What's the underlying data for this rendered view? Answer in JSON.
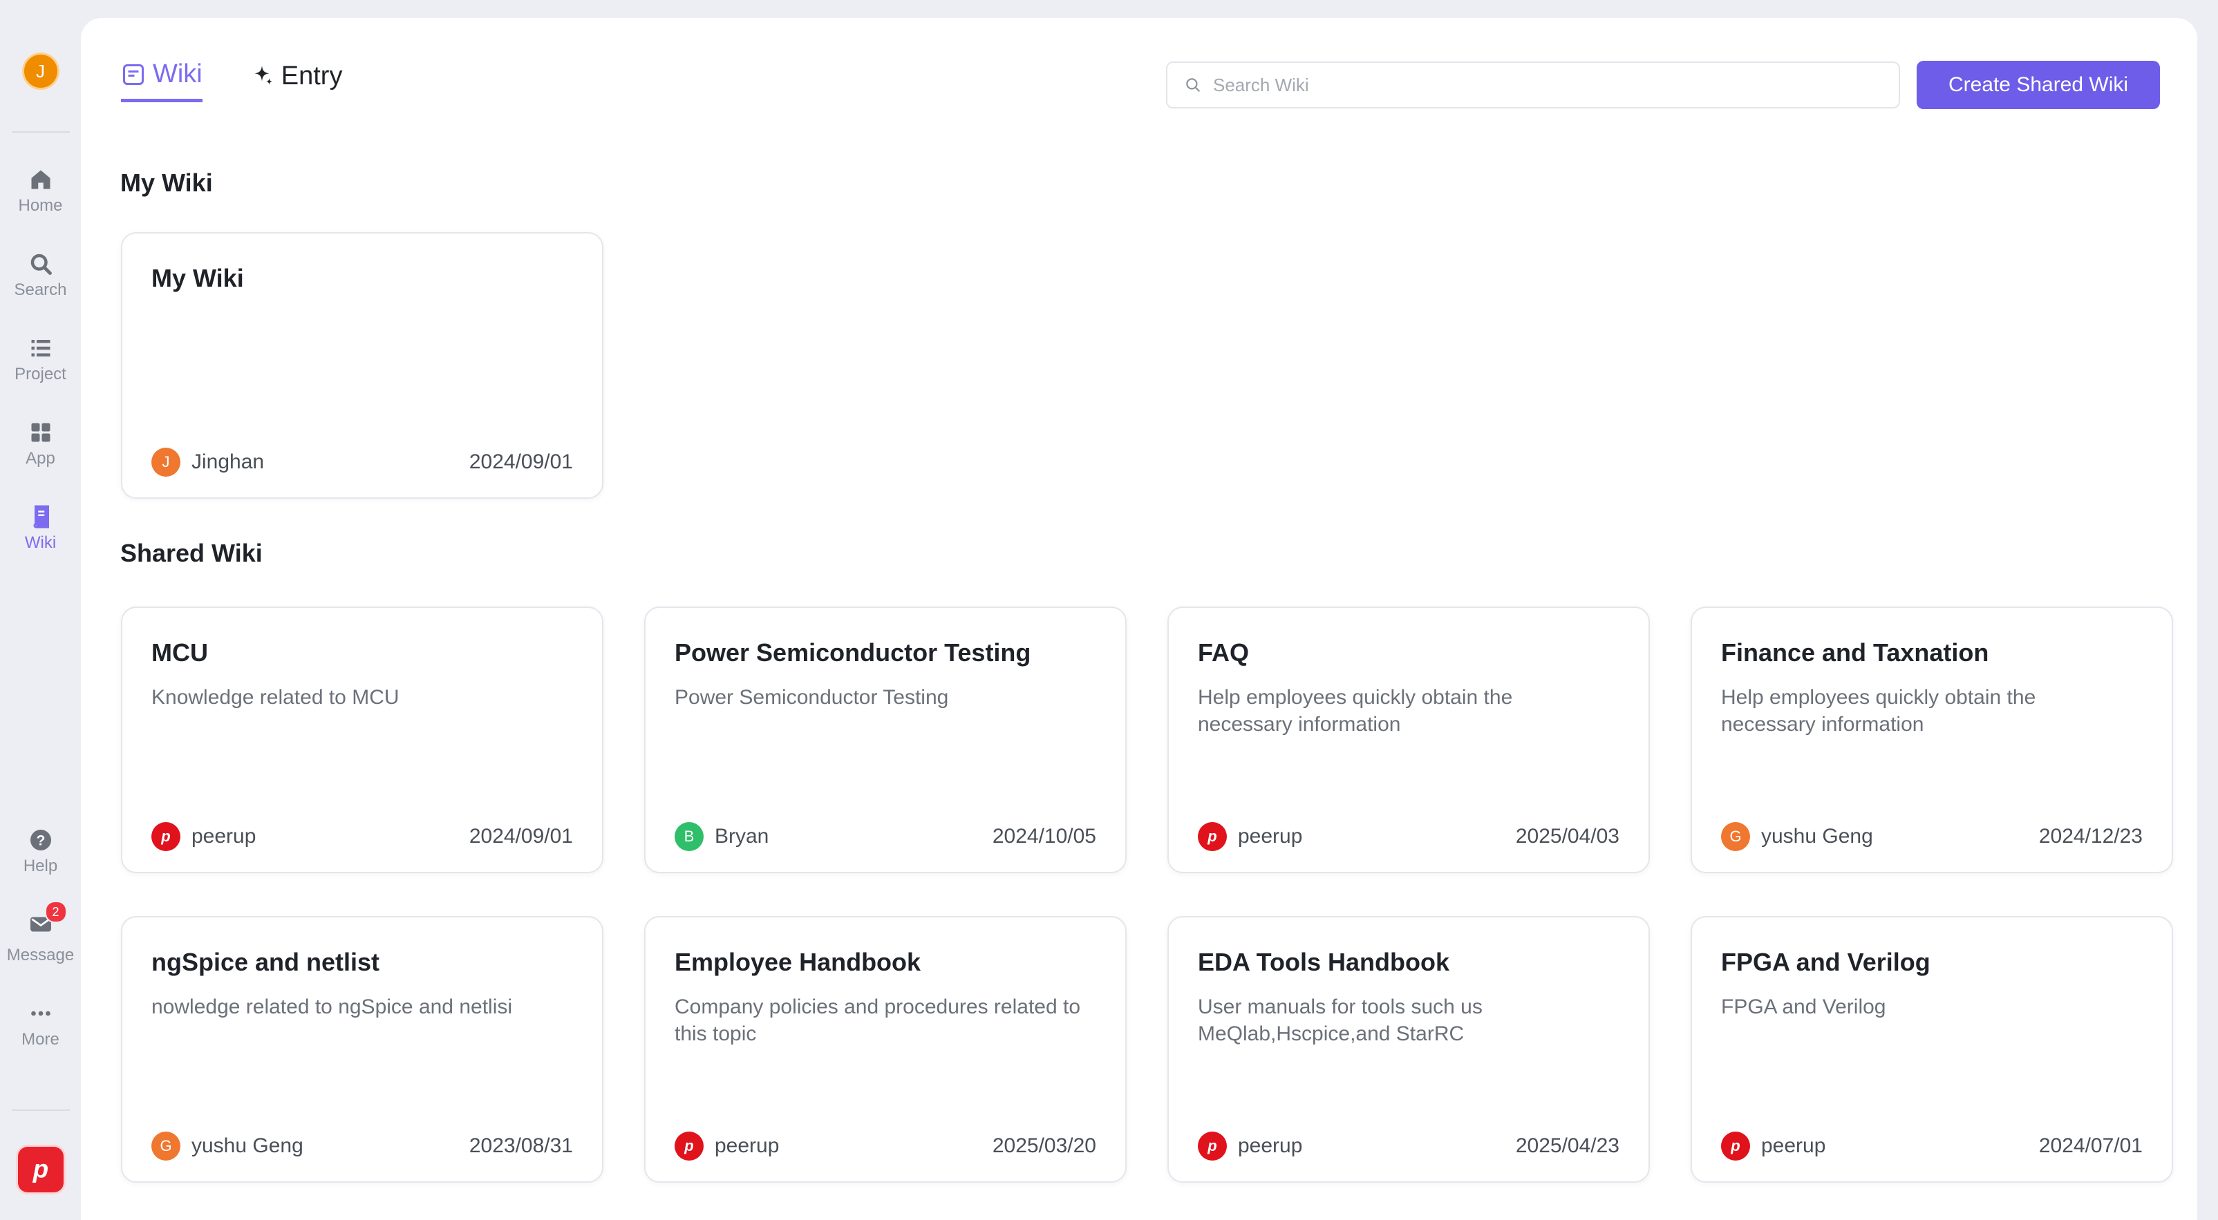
{
  "user": {
    "initial": "J"
  },
  "sidebar": {
    "nav": [
      {
        "label": "Home",
        "icon": "home-icon"
      },
      {
        "label": "Search",
        "icon": "search-icon"
      },
      {
        "label": "Project",
        "icon": "list-icon"
      },
      {
        "label": "App",
        "icon": "grid-icon"
      },
      {
        "label": "Wiki",
        "icon": "book-icon",
        "active": true
      }
    ],
    "bottom": [
      {
        "label": "Help",
        "icon": "help-icon"
      },
      {
        "label": "Message",
        "icon": "mail-icon",
        "badge": "2"
      },
      {
        "label": "More",
        "icon": "more-dots-icon"
      }
    ],
    "logo_letter": "p"
  },
  "header": {
    "tabs": [
      {
        "label": "Wiki",
        "active": true
      },
      {
        "label": "Entry",
        "active": false
      }
    ],
    "search_placeholder": "Search Wiki",
    "create_button": "Create Shared Wiki"
  },
  "sections": {
    "my_wiki_title": "My Wiki",
    "shared_wiki_title": "Shared Wiki"
  },
  "my_wiki": {
    "title": "My Wiki",
    "description": "",
    "owner": "Jinghan",
    "owner_initial": "J",
    "owner_color": "#f0772f",
    "date": "2024/09/01"
  },
  "shared_wikis": [
    {
      "title": "MCU",
      "description": "Knowledge related to MCU",
      "owner": "peerup",
      "owner_initial": "p",
      "owner_color": "#e0121b",
      "date": "2024/09/01"
    },
    {
      "title": "Power Semiconductor Testing",
      "description": "Power Semiconductor Testing",
      "owner": "Bryan",
      "owner_initial": "B",
      "owner_color": "#2fbf6a",
      "date": "2024/10/05"
    },
    {
      "title": "FAQ",
      "description": "Help employees quickly obtain the necessary information",
      "owner": "peerup",
      "owner_initial": "p",
      "owner_color": "#e0121b",
      "date": "2025/04/03"
    },
    {
      "title": "Finance and Taxnation",
      "description": "Help employees quickly obtain the necessary information",
      "owner": "yushu Geng",
      "owner_initial": "G",
      "owner_color": "#f0772f",
      "date": "2024/12/23"
    },
    {
      "title": "ngSpice and netlist",
      "description": "nowledge related to ngSpice and netlisi",
      "owner": "yushu Geng",
      "owner_initial": "G",
      "owner_color": "#f0772f",
      "date": "2023/08/31"
    },
    {
      "title": "Employee Handbook",
      "description": "Company policies and procedures related to this topic",
      "owner": "peerup",
      "owner_initial": "p",
      "owner_color": "#e0121b",
      "date": "2025/03/20"
    },
    {
      "title": "EDA Tools Handbook",
      "description": "User manuals for tools such us MeQlab,Hscpice,and StarRC",
      "owner": "peerup",
      "owner_initial": "p",
      "owner_color": "#e0121b",
      "date": "2025/04/23"
    },
    {
      "title": "FPGA and Verilog",
      "description": "FPGA and Verilog",
      "owner": "peerup",
      "owner_initial": "p",
      "owner_color": "#e0121b",
      "date": "2024/07/01"
    }
  ]
}
